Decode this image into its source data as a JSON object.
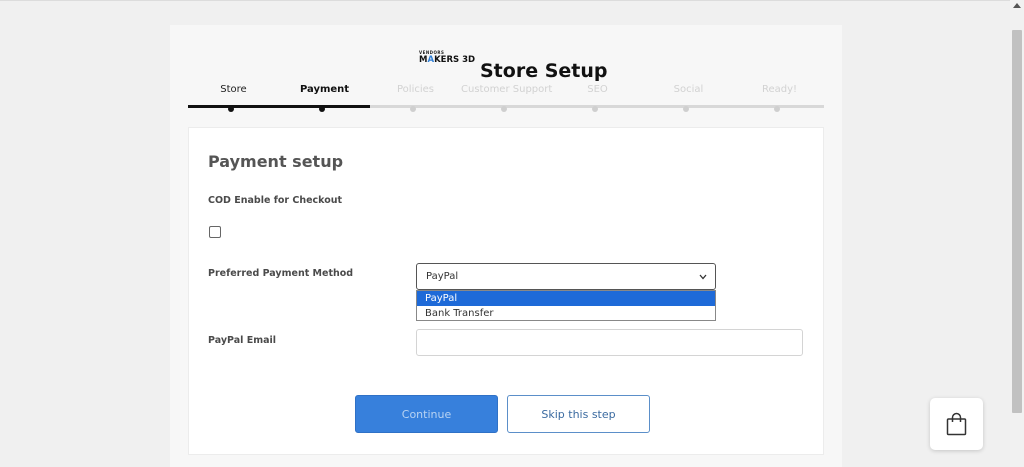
{
  "logo": {
    "small_text": "VENDORS",
    "main_text_prefix": "M",
    "main_text_accent": "A",
    "main_text_rest": "KERS 3D"
  },
  "page_title": "Store Setup",
  "steps": [
    {
      "label": "Store",
      "state": "done"
    },
    {
      "label": "Payment",
      "state": "active"
    },
    {
      "label": "Policies",
      "state": "upcoming"
    },
    {
      "label": "Customer Support",
      "state": "upcoming"
    },
    {
      "label": "SEO",
      "state": "upcoming"
    },
    {
      "label": "Social",
      "state": "upcoming"
    },
    {
      "label": "Ready!",
      "state": "upcoming"
    }
  ],
  "form": {
    "section_title": "Payment setup",
    "cod_label": "COD Enable for Checkout",
    "cod_checked": false,
    "payment_method_label": "Preferred Payment Method",
    "payment_method_value": "PayPal",
    "payment_method_options": [
      "PayPal",
      "Bank Transfer"
    ],
    "paypal_email_label": "PayPal Email",
    "paypal_email_value": ""
  },
  "buttons": {
    "continue_label": "Continue",
    "skip_label": "Skip this step"
  },
  "icons": {
    "dropdown": "chevron-down-icon",
    "cart": "shopping-bag-icon"
  },
  "colors": {
    "accent": "#3780dc",
    "option_highlight": "#1e6ad8",
    "active_step": "#111111"
  }
}
